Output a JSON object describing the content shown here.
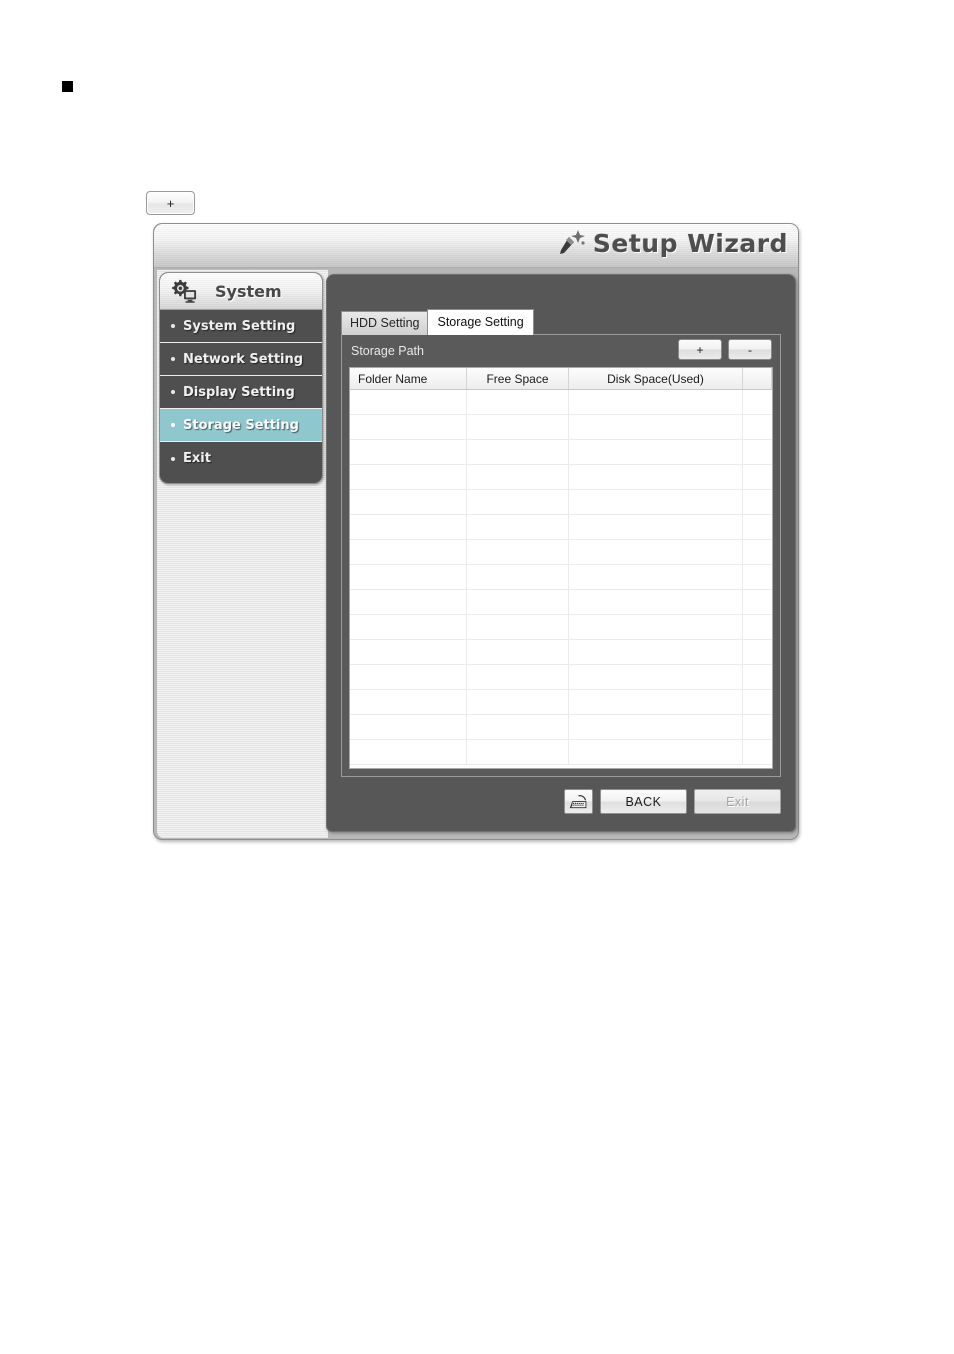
{
  "page": {
    "bullet_marker": "square-bullet",
    "standalone_plus_label": "+"
  },
  "window": {
    "title": "Setup Wizard",
    "wand_icon": "magic-wand-icon"
  },
  "nav": {
    "header": {
      "label": "System",
      "icon": "gear-monitor-icon"
    },
    "items": [
      {
        "label": "System Setting",
        "active": false
      },
      {
        "label": "Network Setting",
        "active": false
      },
      {
        "label": "Display Setting",
        "active": false
      },
      {
        "label": "Storage Setting",
        "active": true
      },
      {
        "label": "Exit",
        "active": false
      }
    ],
    "active_bg_color": "#8fc7ce"
  },
  "tabs": [
    {
      "label": "HDD Setting",
      "active": false
    },
    {
      "label": "Storage Setting",
      "active": true
    }
  ],
  "storage_panel": {
    "path_label": "Storage Path",
    "add_button_label": "+",
    "remove_button_label": "-",
    "table": {
      "columns": [
        "Folder Name",
        "Free Space",
        "Disk Space(Used)",
        ""
      ],
      "rows": [],
      "empty_row_count": 15
    }
  },
  "footer": {
    "keyboard_button_icon": "virtual-keyboard-icon",
    "back_label": "BACK",
    "exit_label": "Exit",
    "exit_disabled": true
  }
}
